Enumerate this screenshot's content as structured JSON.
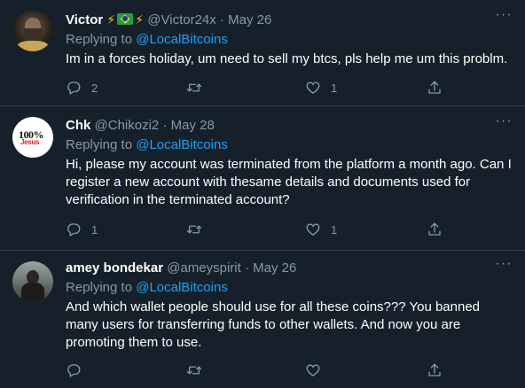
{
  "colors": {
    "background": "#15202b",
    "divider": "#38444d",
    "secondary_text": "#8899a6",
    "link": "#1da1f2",
    "primary_text": "#ffffff"
  },
  "tweets": [
    {
      "name": "Victor",
      "name_decor": [
        "⚡",
        "🇧🇷",
        "⚡"
      ],
      "handle": "@Victor24x",
      "date": "May 26",
      "replying_prefix": "Replying to",
      "replying_to": "@LocalBitcoins",
      "text": "Im in a forces holiday, um need to sell my btcs, pls help me um this problm.",
      "reply_count": "2",
      "retweet_count": "",
      "like_count": "1"
    },
    {
      "name": "Chk",
      "handle": "@Chikozi2",
      "date": "May 28",
      "replying_prefix": "Replying to",
      "replying_to": "@LocalBitcoins",
      "text": "Hi, please my account was terminated from the platform a month ago. Can I register a new account with thesame details and documents used for verification in the terminated account?",
      "avatar_text_top": "100%",
      "avatar_text_bottom": "Jesus",
      "reply_count": "1",
      "retweet_count": "",
      "like_count": "1"
    },
    {
      "name": "amey bondekar",
      "handle": "@ameyspirit",
      "date": "May 26",
      "replying_prefix": "Replying to",
      "replying_to": "@LocalBitcoins",
      "text": "And which wallet people should use for all these coins??? You banned many users for transferring funds to other wallets. And now you are promoting them to use.",
      "reply_count": "",
      "retweet_count": "",
      "like_count": ""
    }
  ],
  "icons": {
    "more": "more-horizontal-icon",
    "reply": "reply-icon",
    "retweet": "retweet-icon",
    "like": "heart-icon",
    "share": "share-icon"
  },
  "separator": "·"
}
